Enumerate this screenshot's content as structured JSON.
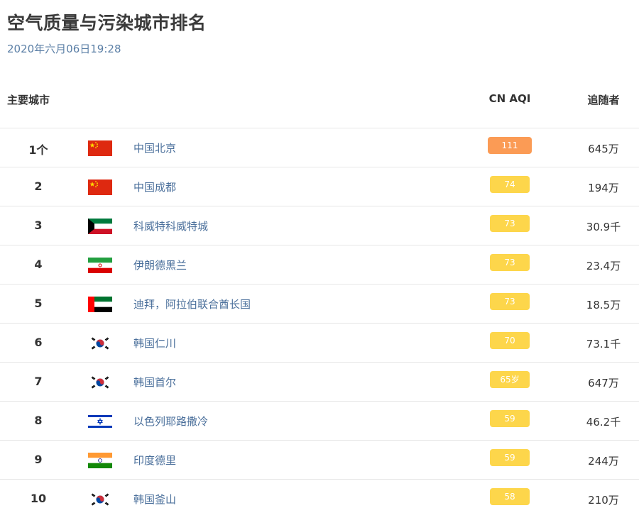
{
  "title": "空气质量与污染城市排名",
  "timestamp": "2020年六月06日19:28",
  "headers": {
    "city": "主要城市",
    "aqi": "CN AQI",
    "followers": "追随者"
  },
  "colors": {
    "aqi_orange": "#fb9b55",
    "aqi_yellow": "#fdd64b",
    "city_link": "#4a6f9b",
    "timestamp": "#5b7fa6"
  },
  "rows": [
    {
      "rank": "1个",
      "flag": "china-flag-icon",
      "city": "中国北京",
      "aqi": "111",
      "aqi_level": "orange",
      "followers": "645万"
    },
    {
      "rank": "2",
      "flag": "china-flag-icon",
      "city": "中国成都",
      "aqi": "74",
      "aqi_level": "yellow",
      "followers": "194万"
    },
    {
      "rank": "3",
      "flag": "kuwait-flag-icon",
      "city": "科威特科威特城",
      "aqi": "73",
      "aqi_level": "yellow",
      "followers": "30.9千"
    },
    {
      "rank": "4",
      "flag": "iran-flag-icon",
      "city": "伊朗德黑兰",
      "aqi": "73",
      "aqi_level": "yellow",
      "followers": "23.4万"
    },
    {
      "rank": "5",
      "flag": "uae-flag-icon",
      "city": "迪拜，阿拉伯联合酋长国",
      "aqi": "73",
      "aqi_level": "yellow",
      "followers": "18.5万"
    },
    {
      "rank": "6",
      "flag": "south-korea-flag-icon",
      "city": "韩国仁川",
      "aqi": "70",
      "aqi_level": "yellow",
      "followers": "73.1千"
    },
    {
      "rank": "7",
      "flag": "south-korea-flag-icon",
      "city": "韩国首尔",
      "aqi": "65岁",
      "aqi_level": "yellow",
      "followers": "647万"
    },
    {
      "rank": "8",
      "flag": "israel-flag-icon",
      "city": "以色列耶路撒冷",
      "aqi": "59",
      "aqi_level": "yellow",
      "followers": "46.2千"
    },
    {
      "rank": "9",
      "flag": "india-flag-icon",
      "city": "印度德里",
      "aqi": "59",
      "aqi_level": "yellow",
      "followers": "244万"
    },
    {
      "rank": "10",
      "flag": "south-korea-flag-icon",
      "city": "韩国釜山",
      "aqi": "58",
      "aqi_level": "yellow",
      "followers": "210万"
    }
  ]
}
